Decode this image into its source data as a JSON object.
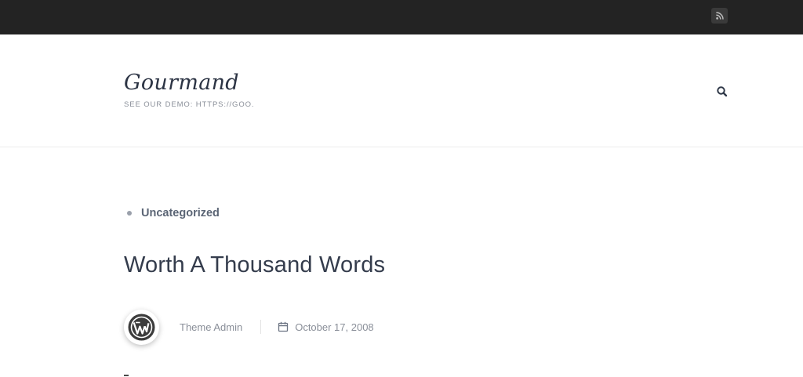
{
  "topbar": {
    "background": "#232323",
    "rss_icon": "rss-icon"
  },
  "header": {
    "site_title": "Gourmand",
    "tagline": "SEE OUR DEMO: HTTPS://GOO.",
    "search_icon": "search-icon"
  },
  "post": {
    "category": "Uncategorized",
    "title": "Worth A Thousand Words",
    "author": "Theme Admin",
    "date": "October 17, 2008",
    "avatar_icon": "wordpress-logo-icon",
    "calendar_icon": "calendar-icon"
  },
  "colors": {
    "text_dark": "#343c4c",
    "text_muted": "#8a8f99",
    "accent": "#5b6575"
  }
}
